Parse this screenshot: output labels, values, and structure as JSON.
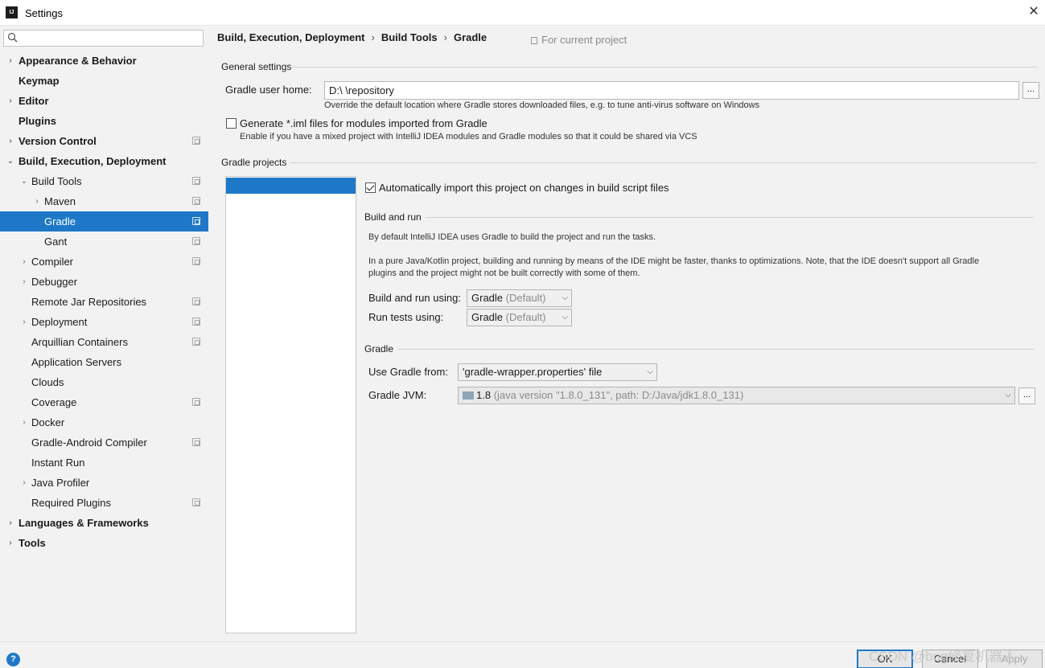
{
  "window": {
    "title": "Settings",
    "app_icon_text": "IJ",
    "close_glyph": "✕"
  },
  "sidebar": {
    "search_placeholder": "",
    "items": [
      {
        "label": "Appearance & Behavior",
        "arrow": "›"
      },
      {
        "label": "Keymap"
      },
      {
        "label": "Editor",
        "arrow": "›"
      },
      {
        "label": "Plugins"
      },
      {
        "label": "Version Control",
        "arrow": "›"
      },
      {
        "label": "Build, Execution, Deployment",
        "arrow": "⌄"
      },
      {
        "label": "Build Tools",
        "arrow": "⌄"
      },
      {
        "label": "Maven",
        "arrow": "›"
      },
      {
        "label": "Gradle"
      },
      {
        "label": "Gant"
      },
      {
        "label": "Compiler",
        "arrow": "›"
      },
      {
        "label": "Debugger",
        "arrow": "›"
      },
      {
        "label": "Remote Jar Repositories"
      },
      {
        "label": "Deployment",
        "arrow": "›"
      },
      {
        "label": "Arquillian Containers"
      },
      {
        "label": "Application Servers"
      },
      {
        "label": "Clouds"
      },
      {
        "label": "Coverage"
      },
      {
        "label": "Docker",
        "arrow": "›"
      },
      {
        "label": "Gradle-Android Compiler"
      },
      {
        "label": "Instant Run"
      },
      {
        "label": "Java Profiler",
        "arrow": "›"
      },
      {
        "label": "Required Plugins"
      },
      {
        "label": "Languages & Frameworks",
        "arrow": "›"
      },
      {
        "label": "Tools",
        "arrow": "›"
      }
    ]
  },
  "breadcrumb": {
    "part1": "Build, Execution, Deployment",
    "part2": "Build Tools",
    "part3": "Gradle",
    "separator": "›"
  },
  "scope_label": "For current project",
  "general": {
    "section_title": "General settings",
    "user_home_label": "Gradle user home:",
    "user_home_value": "D:\\          \\repository",
    "browse_label": "...",
    "user_home_note": "Override the default location where Gradle stores downloaded files, e.g. to tune anti-virus software on Windows",
    "iml_label": "Generate *.iml files for modules imported from Gradle",
    "iml_note": "Enable if you have a mixed project with IntelliJ IDEA modules and Gradle modules so that it could be shared via VCS"
  },
  "projects": {
    "section_title": "Gradle projects",
    "selected_project": "",
    "auto_import_label": "Automatically import this project on changes in build script files",
    "build_run_title": "Build and run",
    "build_run_note1": "By default IntelliJ IDEA uses Gradle to build the project and run the tasks.",
    "build_run_note2a": "In a pure Java/Kotlin project, building and running by means of the IDE might be faster, thanks to optimizations. Note, that the IDE doesn't support all Gradle",
    "build_run_note2b": "plugins and the project might not be built correctly with some of them.",
    "build_run_using_label": "Build and run using:",
    "build_run_using_value": "Gradle",
    "build_run_using_suffix": "(Default)",
    "run_tests_label": "Run tests using:",
    "run_tests_value": "Gradle",
    "run_tests_suffix": "(Default)",
    "gradle_title": "Gradle",
    "use_gradle_from_label": "Use Gradle from:",
    "use_gradle_from_value": "'gradle-wrapper.properties' file",
    "jvm_label": "Gradle JVM:",
    "jvm_version": "1.8",
    "jvm_detail": "(java version \"1.8.0_131\", path: D:/Java/jdk1.8.0_131)",
    "jvm_browse": "..."
  },
  "footer": {
    "help": "?",
    "ok": "OK",
    "cancel": "Cancel",
    "apply": "Apply",
    "watermark": "CSDN @bug修复机器人"
  }
}
